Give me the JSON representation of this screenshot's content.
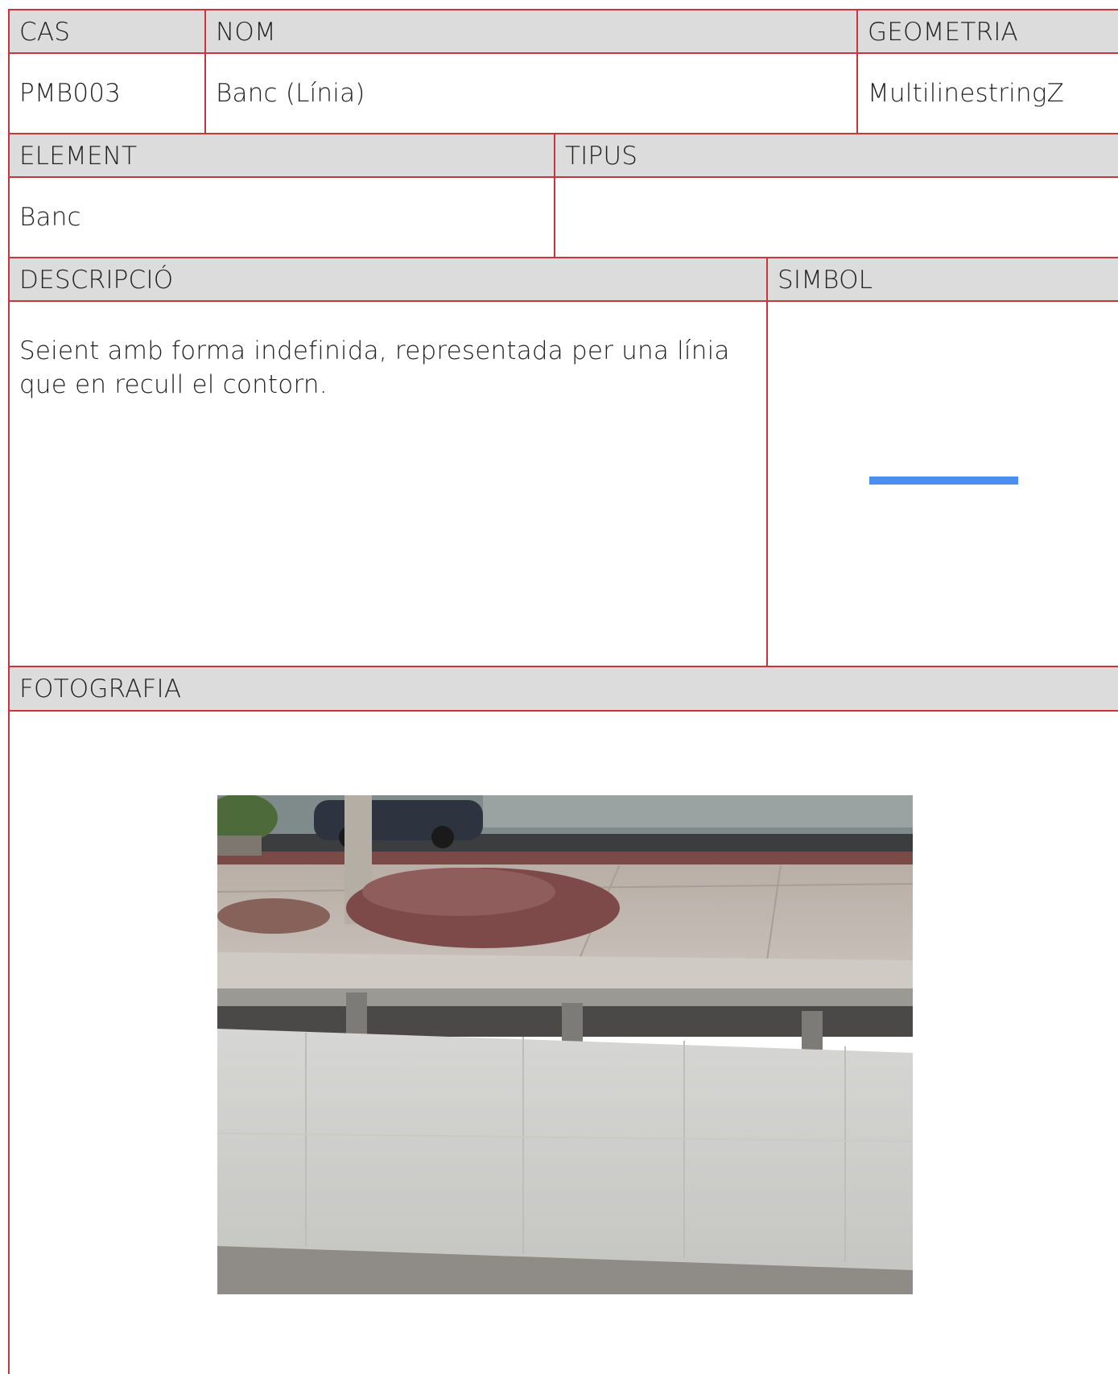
{
  "row1": {
    "cas_label": "CAS",
    "nom_label": "NOM",
    "geometria_label": "GEOMETRIA"
  },
  "row2": {
    "cas_value": "PMB003",
    "nom_value": "Banc (Línia)",
    "geometria_value": "MultilinestringZ"
  },
  "row3": {
    "element_label": "ELEMENT",
    "tipus_label": "TIPUS"
  },
  "row4": {
    "element_value": "Banc",
    "tipus_value": ""
  },
  "row5": {
    "descripcio_label": "DESCRIPCIÓ",
    "simbol_label": "SIMBOL"
  },
  "descripcio_text": "Seient amb forma indefinida, representada per una línia que en recull el contorn.",
  "simbol": {
    "line_color": "#4a8ef0"
  },
  "fotografia_label": "FOTOGRAFIA",
  "colors": {
    "border": "#c8353f",
    "header_bg": "#dcdcdc"
  }
}
